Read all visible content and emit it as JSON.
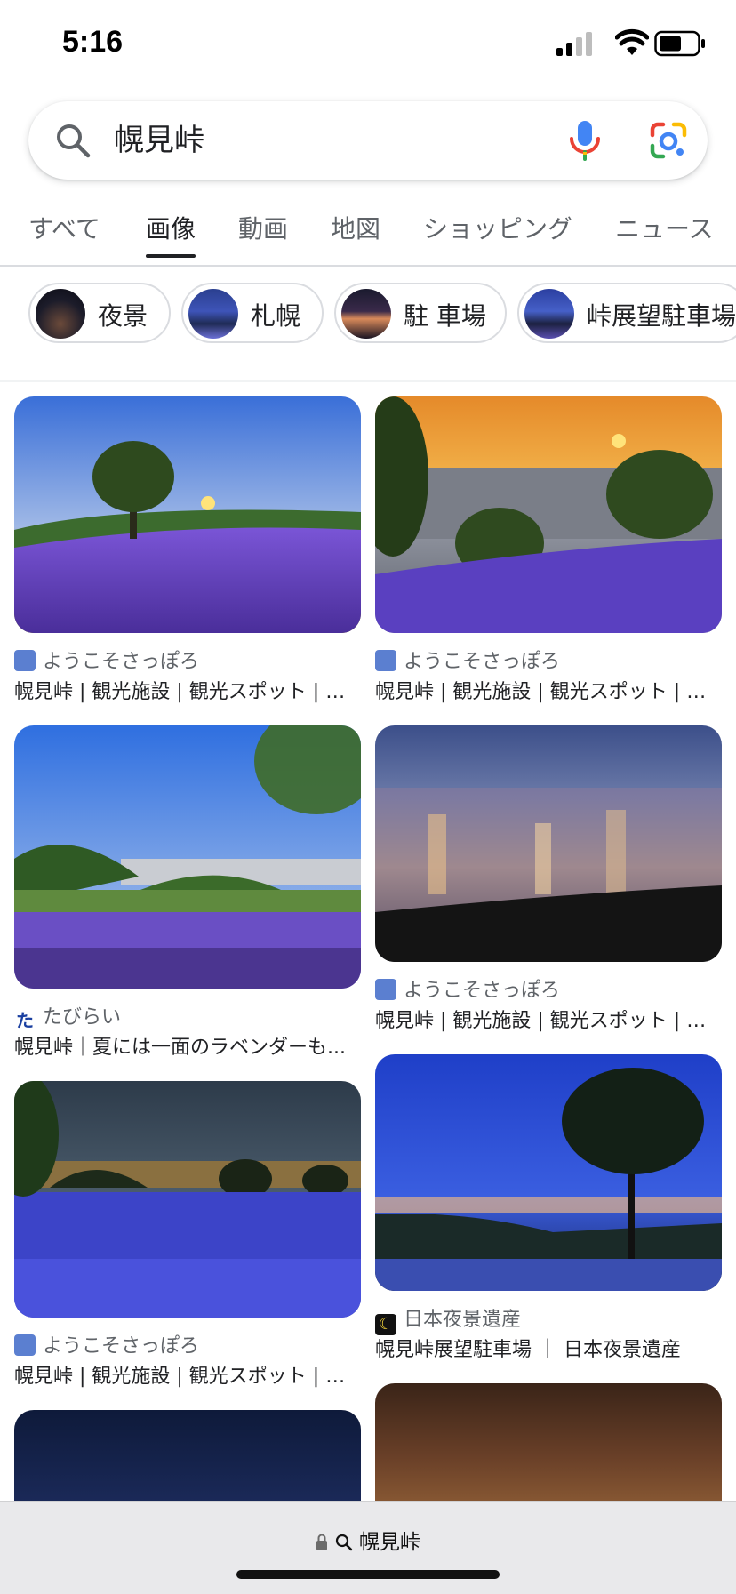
{
  "status_bar": {
    "time": "5:16"
  },
  "search": {
    "query": "幌見峠"
  },
  "tabs": [
    {
      "label": "すべて",
      "active": false
    },
    {
      "label": "画像",
      "active": true
    },
    {
      "label": "動画",
      "active": false
    },
    {
      "label": "地図",
      "active": false
    },
    {
      "label": "ショッピング",
      "active": false
    },
    {
      "label": "ニュース",
      "active": false
    }
  ],
  "chips": [
    {
      "label": "夜景"
    },
    {
      "label": "札幌"
    },
    {
      "label": "駐 車場"
    },
    {
      "label": "峠展望駐車場"
    }
  ],
  "results": [
    {
      "source": "ようこそさっぽろ",
      "title": "幌見峠 | 観光施設 | 観光スポット | よ..."
    },
    {
      "source": "ようこそさっぽろ",
      "title": "幌見峠 | 観光施設 | 観光スポット | よ..."
    },
    {
      "source": "たびらい",
      "title": "幌見峠｜夏には一面のラベンダーも..."
    },
    {
      "source": "ようこそさっぽろ",
      "title": "幌見峠 | 観光施設 | 観光スポット | よ..."
    },
    {
      "source": "ようこそさっぽろ",
      "title": "幌見峠 | 観光施設 | 観光スポット | よ..."
    },
    {
      "source": "日本夜景遺産",
      "title": "幌見峠展望駐車場 ｜ 日本夜景遺産"
    }
  ],
  "bottom_bar": {
    "url": "幌見峠"
  },
  "colors": {
    "accent": "#1a73e8",
    "lavender": "#6a4fd0",
    "text": "#202124",
    "secondary": "#5f6368"
  }
}
